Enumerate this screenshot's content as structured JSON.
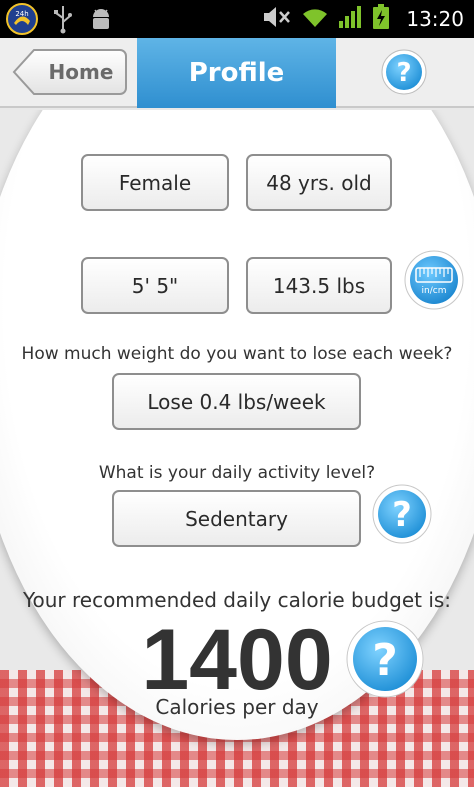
{
  "status_bar": {
    "time": "13:20",
    "app_icon_text": "24h",
    "icons": [
      "app-launcher-icon",
      "usb-icon",
      "android-debug-icon",
      "mute-icon",
      "wifi-icon",
      "signal-icon",
      "battery-charging-icon"
    ]
  },
  "header": {
    "home_label": "Home",
    "title": "Profile",
    "help_label": "?"
  },
  "profile": {
    "gender": "Female",
    "age": "48 yrs. old",
    "height": "5' 5\"",
    "weight": "143.5 lbs",
    "units_toggle": "in/cm"
  },
  "goal": {
    "question": "How much weight do you want to lose each week?",
    "value": "Lose 0.4 lbs/week"
  },
  "activity": {
    "question": "What is your daily activity level?",
    "value": "Sedentary",
    "help_label": "?"
  },
  "budget": {
    "heading": "Your recommended daily calorie budget is:",
    "calories": "1400",
    "unit": "Calories per day",
    "help_label": "?"
  },
  "colors": {
    "tab_blue": "#3b9ad9",
    "help_blue": "#2aa6e8",
    "checker_red": "#d63a3a"
  }
}
